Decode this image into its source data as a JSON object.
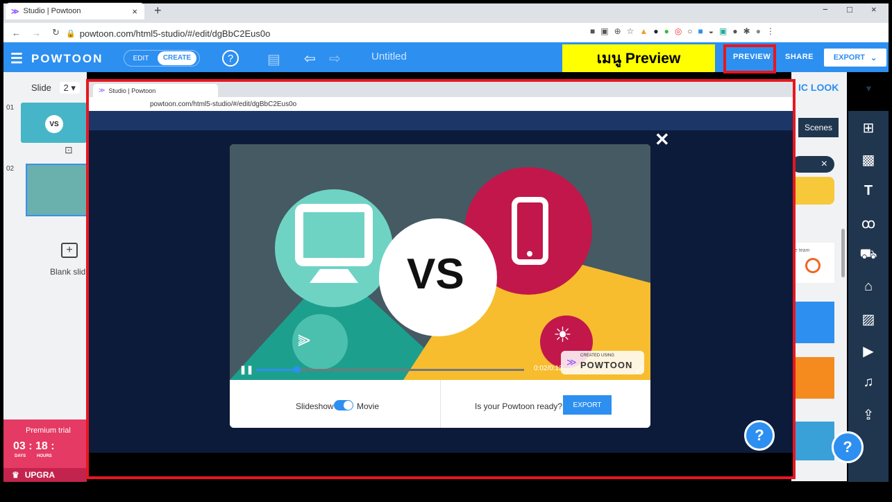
{
  "browser": {
    "tab_title": "Studio | Powtoon",
    "tab_close": "×",
    "new_tab": "+",
    "url": "powtoon.com/html5-studio/#/edit/dgBbC2Eus0o",
    "win_min": "−",
    "win_max": "□",
    "win_close": "×"
  },
  "header": {
    "logo": "POWTOON",
    "mode_edit": "EDIT",
    "mode_create": "CREATE",
    "help": "?",
    "title": "Untitled",
    "preview": "PREVIEW",
    "share": "SHARE",
    "export": "EXPORT",
    "export_caret": "⌄"
  },
  "annotation": {
    "label": "เมนู Preview"
  },
  "left_panel": {
    "slide_label": "Slide",
    "slide_value": "2 ▾",
    "slide1_num": "01",
    "slide2_num": "02",
    "thumb1_text": "VS",
    "blank_slide": "Blank slid",
    "premium": "Premium trial",
    "countdown": "03 : 18 :",
    "days": "DAYS",
    "hours": "HOURS",
    "upgrade": "UPGRA"
  },
  "right_panel": {
    "look_title": "IC LOOK",
    "look_caret": "▼",
    "scenes_tip": "Scenes",
    "close_chip": "×",
    "team_label": "e team"
  },
  "inner": {
    "tab_title": "Studio | Powtoon",
    "url": "powtoon.com/html5-studio/#/edit/dgBbC2Eus0o",
    "close": "✕",
    "vs": "VS",
    "time": "0:02/0:13",
    "created_using": "CREATED USING",
    "powtoon_brand": "POWTOON",
    "slideshow": "Slideshow",
    "movie": "Movie",
    "ready": "Is your Powtoon ready?",
    "export": "EXPORT",
    "help": "?"
  },
  "colors": {
    "powtoon_blue": "#2d8ff0",
    "highlight_red": "#e8161f",
    "annotation_yellow": "#ffff00",
    "teal": "#6fd3c4",
    "crimson": "#c2174b",
    "gold": "#f7bd2f"
  }
}
